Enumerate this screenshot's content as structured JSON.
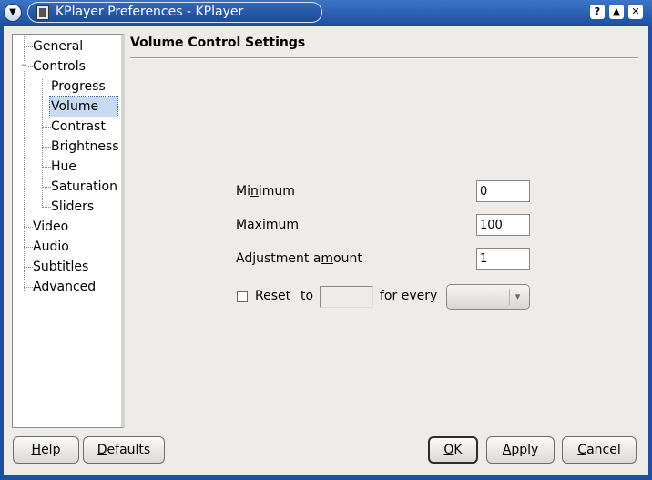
{
  "window": {
    "title": "KPlayer Preferences - KPlayer",
    "buttons": {
      "help": "?",
      "shade": "▲",
      "close": "✕"
    }
  },
  "tree": {
    "items": [
      {
        "label": "General",
        "level": 0
      },
      {
        "label": "Controls",
        "level": 0,
        "expanded": true
      },
      {
        "label": "Progress",
        "level": 1
      },
      {
        "label": "Volume",
        "level": 1,
        "selected": true
      },
      {
        "label": "Contrast",
        "level": 1
      },
      {
        "label": "Brightness",
        "level": 1
      },
      {
        "label": "Hue",
        "level": 1
      },
      {
        "label": "Saturation",
        "level": 1
      },
      {
        "label": "Sliders",
        "level": 1
      },
      {
        "label": "Video",
        "level": 0
      },
      {
        "label": "Audio",
        "level": 0
      },
      {
        "label": "Subtitles",
        "level": 0
      },
      {
        "label": "Advanced",
        "level": 0
      }
    ]
  },
  "panel": {
    "title": "Volume Control Settings",
    "minimum": {
      "pre": "Mi",
      "key": "n",
      "post": "imum",
      "value": "0"
    },
    "maximum": {
      "pre": "Ma",
      "key": "x",
      "post": "imum",
      "value": "100"
    },
    "adjustment": {
      "pre": "Adjustment a",
      "key": "m",
      "post": "ount",
      "value": "1"
    },
    "reset": {
      "checked": false,
      "label_key": "R",
      "label_post": "eset",
      "to_pre": "t",
      "to_key": "o",
      "for_pre": "for ",
      "for_key": "e",
      "for_post": "very",
      "to_value": "",
      "every_value": ""
    }
  },
  "footer": {
    "help": {
      "key": "H",
      "rest": "elp"
    },
    "defaults": {
      "key": "D",
      "rest": "efaults"
    },
    "ok": {
      "key": "O",
      "rest": "K"
    },
    "apply": {
      "key": "A",
      "rest": "pply"
    },
    "cancel": {
      "key": "C",
      "rest": "ancel"
    }
  },
  "colors": {
    "titlebar": "#1f4fa0",
    "background": "#eeebe8",
    "selection": "#c7daf2"
  }
}
